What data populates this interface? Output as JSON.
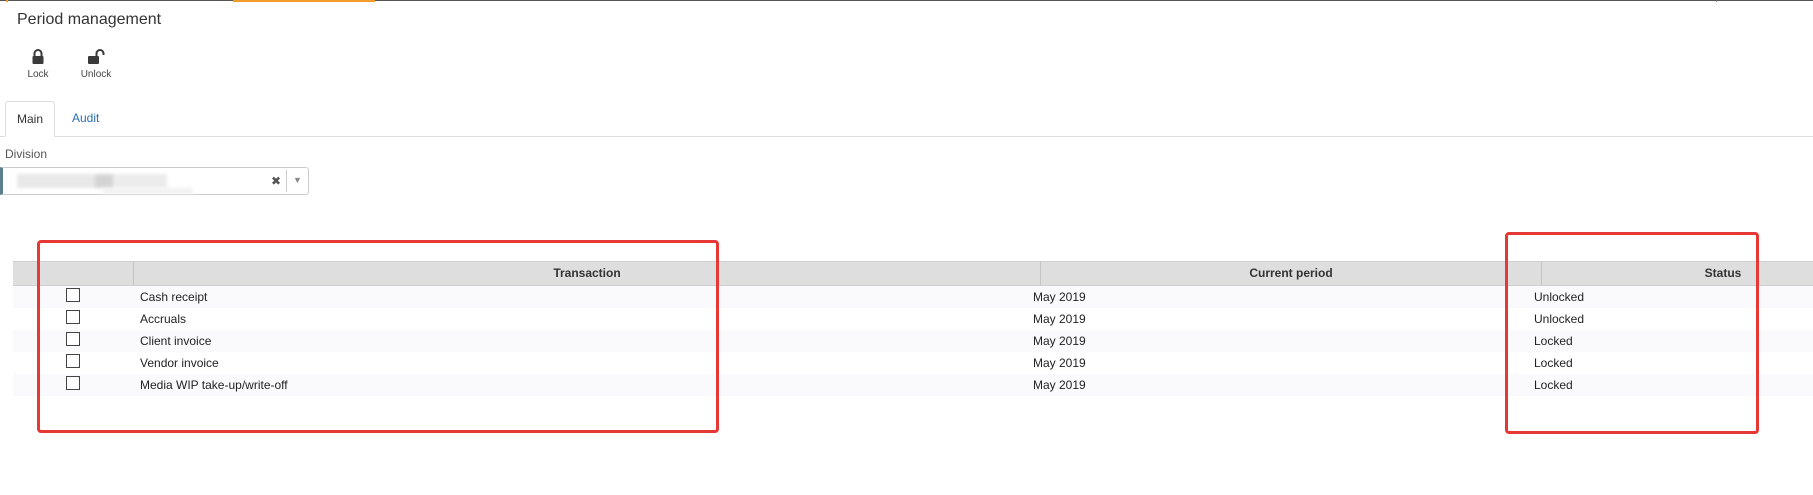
{
  "page": {
    "title": "Period management"
  },
  "toolbar": {
    "lock_label": "Lock",
    "unlock_label": "Unlock"
  },
  "tabs": [
    {
      "label": "Main",
      "active": true
    },
    {
      "label": "Audit",
      "active": false
    }
  ],
  "division": {
    "label": "Division",
    "clear_glyph": "✖",
    "caret_glyph": "▼"
  },
  "grid": {
    "columns": [
      "",
      "Transaction",
      "Current period",
      "Status"
    ],
    "rows": [
      {
        "checked": false,
        "transaction": "Cash receipt",
        "period": "May 2019",
        "status": "Unlocked"
      },
      {
        "checked": false,
        "transaction": "Accruals",
        "period": "May 2019",
        "status": "Unlocked"
      },
      {
        "checked": false,
        "transaction": "Client invoice",
        "period": "May 2019",
        "status": "Locked"
      },
      {
        "checked": false,
        "transaction": "Vendor invoice",
        "period": "May 2019",
        "status": "Locked"
      },
      {
        "checked": false,
        "transaction": "Media WIP take-up/write-off",
        "period": "May 2019",
        "status": "Locked"
      }
    ]
  },
  "colors": {
    "accent_orange": "#f39c2b",
    "link_blue": "#2a6fb2",
    "annotation_red": "#e53935"
  },
  "icons": {
    "lock": "lock-icon",
    "unlock": "unlock-icon"
  }
}
